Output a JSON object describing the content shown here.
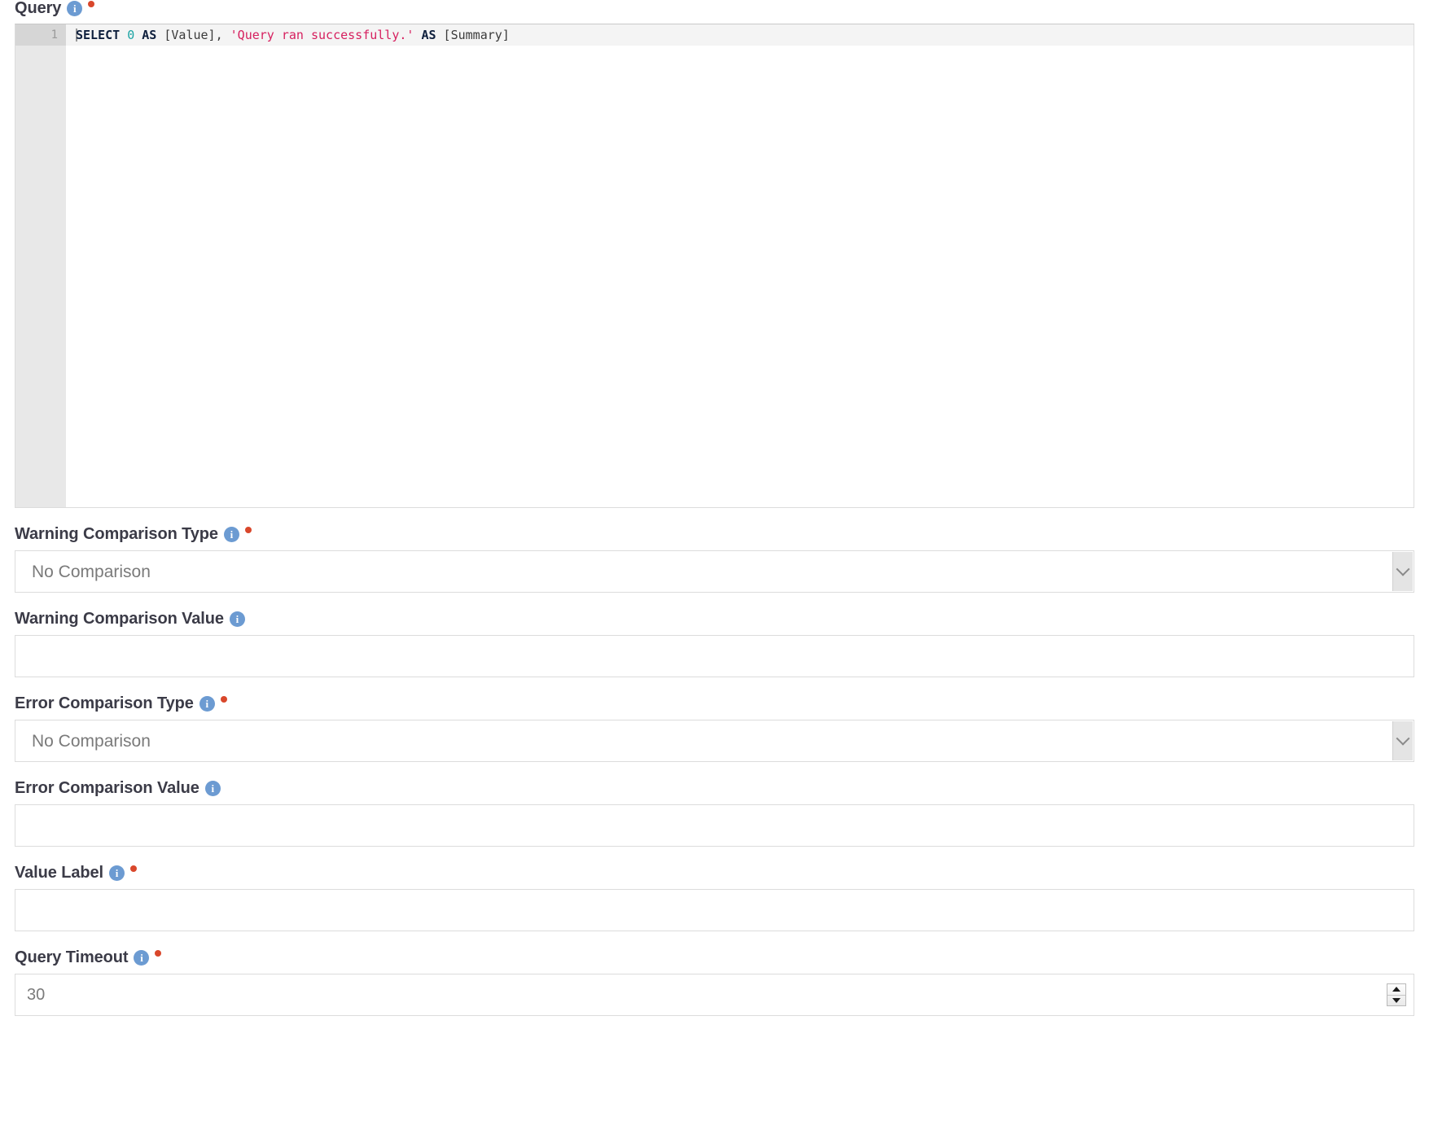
{
  "query_field": {
    "label": "Query",
    "info_icon": "info-icon",
    "required": true,
    "editor": {
      "line_number": "1",
      "tokens": [
        {
          "text": "SELECT",
          "kind": "kw"
        },
        {
          "text": " ",
          "kind": "punct"
        },
        {
          "text": "0",
          "kind": "num"
        },
        {
          "text": " ",
          "kind": "punct"
        },
        {
          "text": "AS",
          "kind": "kw"
        },
        {
          "text": " [Value], ",
          "kind": "ident"
        },
        {
          "text": "'Query ran successfully.'",
          "kind": "str"
        },
        {
          "text": " ",
          "kind": "punct"
        },
        {
          "text": "AS",
          "kind": "kw"
        },
        {
          "text": " [Summary]",
          "kind": "ident"
        }
      ],
      "plain_text": "SELECT 0 AS [Value], 'Query ran successfully.' AS [Summary]"
    }
  },
  "fields": [
    {
      "id": "warning-comparison-type",
      "label": "Warning Comparison Type",
      "info_icon": "info-icon",
      "required": true,
      "control": "select",
      "value": "No Comparison",
      "arrow_icon": "chevron-down-icon"
    },
    {
      "id": "warning-comparison-value",
      "label": "Warning Comparison Value",
      "info_icon": "info-icon",
      "required": false,
      "control": "text",
      "value": "",
      "placeholder": ""
    },
    {
      "id": "error-comparison-type",
      "label": "Error Comparison Type",
      "info_icon": "info-icon",
      "required": true,
      "control": "select",
      "value": "No Comparison",
      "arrow_icon": "chevron-down-icon"
    },
    {
      "id": "error-comparison-value",
      "label": "Error Comparison Value",
      "info_icon": "info-icon",
      "required": false,
      "control": "text",
      "value": "",
      "placeholder": ""
    },
    {
      "id": "value-label",
      "label": "Value Label",
      "info_icon": "info-icon",
      "required": true,
      "control": "text",
      "value": "",
      "placeholder": ""
    },
    {
      "id": "query-timeout",
      "label": "Query Timeout",
      "info_icon": "info-icon",
      "required": true,
      "control": "number",
      "value": "",
      "placeholder": "30",
      "spinner_up_icon": "spinner-up-icon",
      "spinner_down_icon": "spinner-down-icon"
    }
  ],
  "colors": {
    "info_icon_blue": "#6c9bd2",
    "required_dot_red": "#d9472b",
    "label_text": "#3b3b47",
    "border": "#dcdcdc",
    "gutter_bg": "#e8e8e8",
    "gutter_active_bg": "#d6d6d6",
    "active_line_bg": "#f4f4f4",
    "sql_keyword": "#0e1f3d",
    "sql_number": "#1aa3a3",
    "sql_string": "#d6205f",
    "sql_identifier": "#3a3a3a"
  }
}
